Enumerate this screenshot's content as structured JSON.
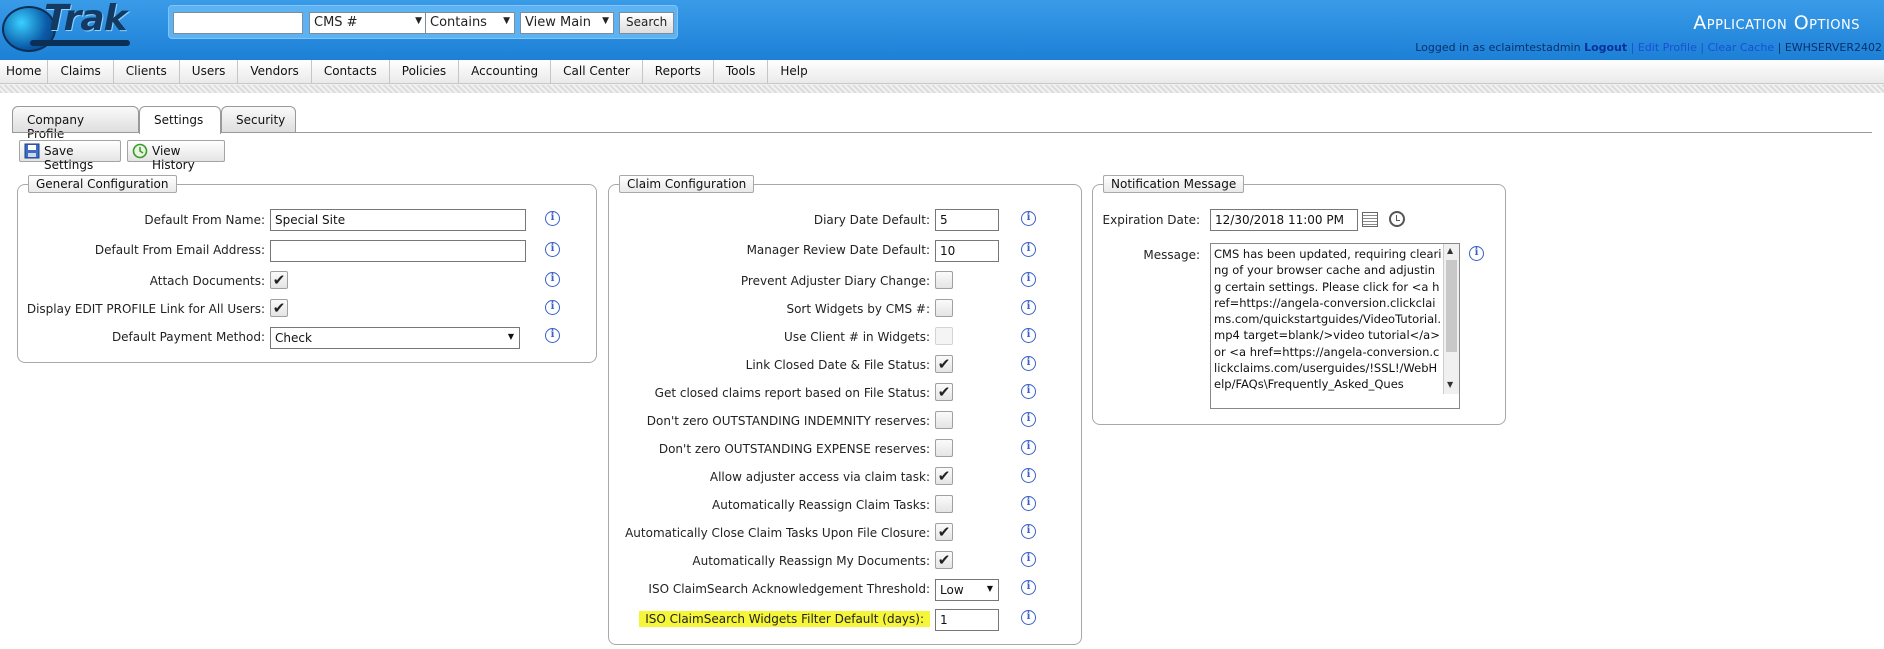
{
  "header": {
    "logo_text": "Trak",
    "app_title": "Application Options",
    "search": {
      "text_value": "",
      "field_select": "CMS #",
      "match_select": "Contains",
      "view_select": "View Main",
      "button_label": "Search"
    },
    "user_line": {
      "logged_in_prefix": "Logged in as eclaimtestadmin",
      "logout": "Logout",
      "sep1": "|",
      "edit_profile": "Edit Profile",
      "sep2": "|",
      "clear_cache": "Clear Cache",
      "sep3": "|",
      "server": "EWHSERVER2402"
    }
  },
  "nav": {
    "items": [
      "Home",
      "Claims",
      "Clients",
      "Users",
      "Vendors",
      "Contacts",
      "Policies",
      "Accounting",
      "Call Center",
      "Reports",
      "Tools",
      "Help"
    ]
  },
  "tabs": [
    {
      "label": "Company Profile",
      "active": false
    },
    {
      "label": "Settings",
      "active": true
    },
    {
      "label": "Security",
      "active": false
    }
  ],
  "toolbar": {
    "save_label": "Save Settings",
    "history_label": "View History"
  },
  "general_config": {
    "legend": "General Configuration",
    "default_from_name_label": "Default From Name:",
    "default_from_name_value": "Special Site",
    "default_from_email_label": "Default From Email Address:",
    "default_from_email_value": "",
    "attach_documents_label": "Attach Documents:",
    "attach_documents_checked": true,
    "display_edit_profile_label": "Display EDIT PROFILE Link for All Users:",
    "display_edit_profile_checked": true,
    "default_payment_method_label": "Default Payment Method:",
    "default_payment_method_value": "Check"
  },
  "claim_config": {
    "legend": "Claim Configuration",
    "diary_date_default_label": "Diary Date Default:",
    "diary_date_default_value": "5",
    "manager_review_label": "Manager Review Date Default:",
    "manager_review_value": "10",
    "checkboxes": [
      {
        "label": "Prevent Adjuster Diary Change:",
        "checked": false,
        "disabled": false
      },
      {
        "label": "Sort Widgets by CMS #:",
        "checked": false,
        "disabled": false
      },
      {
        "label": "Use Client # in Widgets:",
        "checked": false,
        "disabled": true
      },
      {
        "label": "Link Closed Date & File Status:",
        "checked": true,
        "disabled": false
      },
      {
        "label": "Get closed claims report based on File Status:",
        "checked": true,
        "disabled": false
      },
      {
        "label": "Don't zero OUTSTANDING INDEMNITY reserves:",
        "checked": false,
        "disabled": false
      },
      {
        "label": "Don't zero OUTSTANDING EXPENSE reserves:",
        "checked": false,
        "disabled": false
      },
      {
        "label": "Allow adjuster access via claim task:",
        "checked": true,
        "disabled": false
      },
      {
        "label": "Automatically Reassign Claim Tasks:",
        "checked": false,
        "disabled": false
      },
      {
        "label": "Automatically Close Claim Tasks Upon File Closure:",
        "checked": true,
        "disabled": false
      },
      {
        "label": "Automatically Reassign My Documents:",
        "checked": true,
        "disabled": false
      }
    ],
    "iso_threshold_label": "ISO ClaimSearch Acknowledgement Threshold:",
    "iso_threshold_value": "Low",
    "iso_filter_label": "ISO ClaimSearch Widgets Filter Default (days):",
    "iso_filter_value": "1"
  },
  "notification": {
    "legend": "Notification Message",
    "expiration_label": "Expiration Date:",
    "expiration_value": "12/30/2018 11:00 PM",
    "message_label": "Message:",
    "message_value": "CMS has been updated, requiring clearing of your browser cache and adjusting certain settings. Please click for <a href=https://angela-conversion.clickclaims.com/quickstartguides/VideoTutorial.mp4 target=blank/>video tutorial</a> or <a href=https://angela-conversion.clickclaims.com/userguides/!SSL!/WebHelp/FAQs\\Frequently_Asked_Ques"
  },
  "colors": {
    "header_blue": "#1c80d6",
    "highlight_yellow": "#f5f53a",
    "info_blue": "#3a5fc8"
  }
}
